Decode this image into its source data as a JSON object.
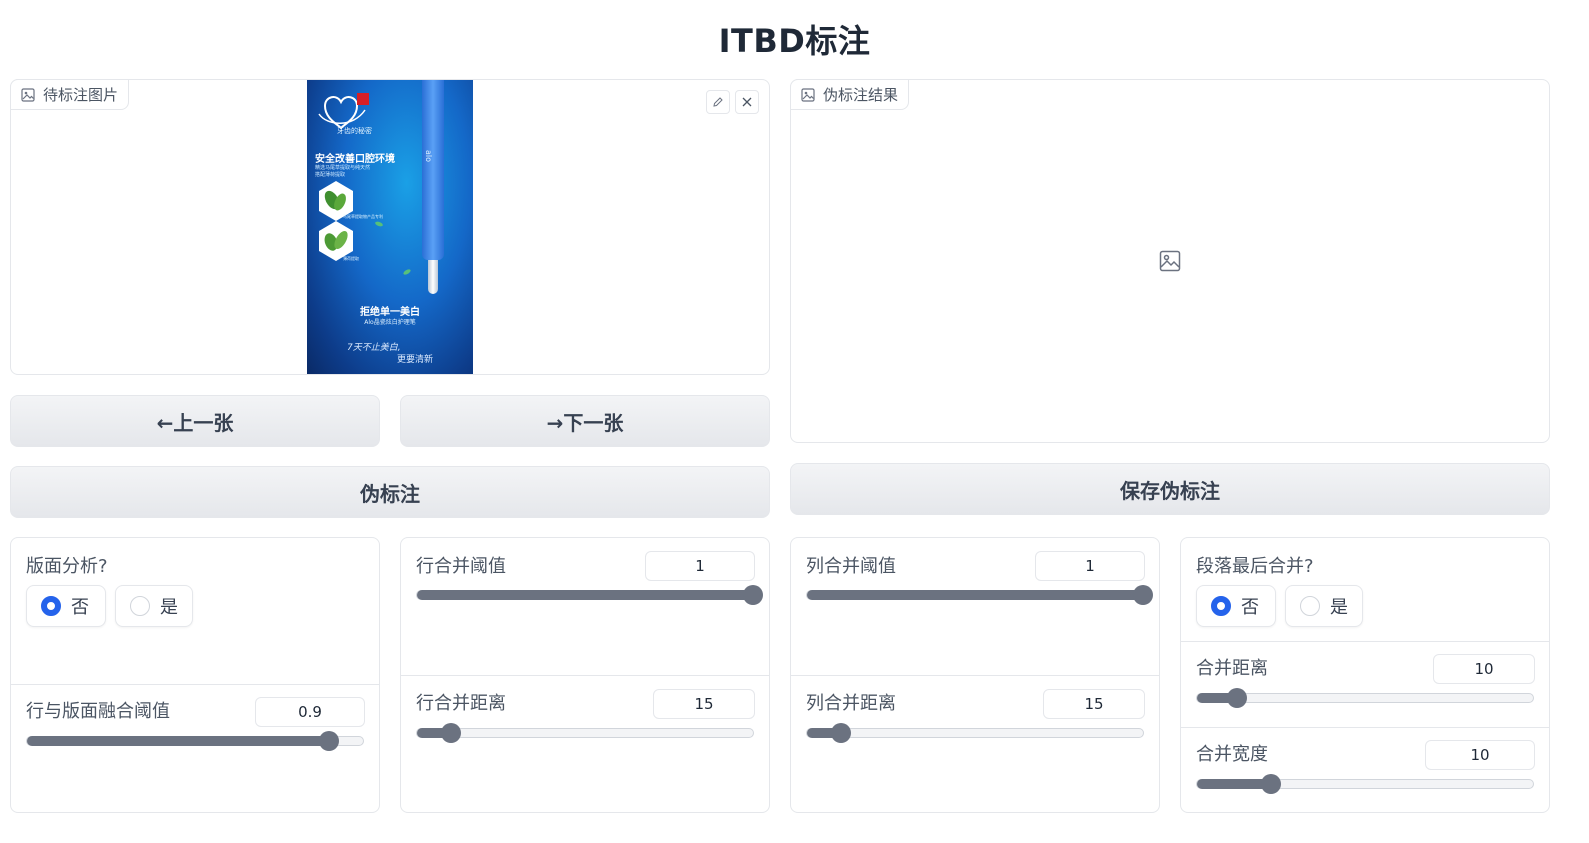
{
  "header": {
    "title": "ITBD标注"
  },
  "input_panel": {
    "label": "待标注图片",
    "poster": {
      "brand": "牙齿的秘密",
      "headline": "安全改善口腔环境",
      "subline1": "精选马尾草提取与纯天然",
      "subline2": "搭配薄荷提取",
      "plant1_caption": "马尾草提取物产品专利",
      "plant2_caption": "薄荷提取",
      "slogan": "拒绝单一美白",
      "product": "Alo晶瓷炫白护理笔",
      "tagline1": "7天不止美白,",
      "tagline2": "更要清新",
      "pen_text": "alo"
    }
  },
  "output_panel": {
    "label": "伪标注结果"
  },
  "buttons": {
    "prev": "←上一张",
    "next": "→下一张",
    "pseudo": "伪标注",
    "save": "保存伪标注"
  },
  "layout_analysis": {
    "label": "版面分析?",
    "options": [
      "否",
      "是"
    ],
    "selected": "否"
  },
  "row_layout_fusion": {
    "label": "行与版面融合阈值",
    "value": "0.9",
    "fraction": 0.9
  },
  "row_merge_threshold": {
    "label": "行合并阈值",
    "value": "1",
    "fraction": 1.0
  },
  "row_merge_distance": {
    "label": "行合并距离",
    "value": "15",
    "fraction": 0.1
  },
  "col_merge_threshold": {
    "label": "列合并阈值",
    "value": "1",
    "fraction": 1.0
  },
  "col_merge_distance": {
    "label": "列合并距离",
    "value": "15",
    "fraction": 0.1
  },
  "paragraph_merge": {
    "label": "段落最后合并?",
    "options": [
      "否",
      "是"
    ],
    "selected": "否"
  },
  "merge_distance": {
    "label": "合并距离",
    "value": "10",
    "fraction": 0.12
  },
  "merge_width": {
    "label": "合并宽度",
    "value": "10",
    "fraction": 0.22
  },
  "colors": {
    "accent": "#2563eb",
    "slider": "#6b7280"
  }
}
